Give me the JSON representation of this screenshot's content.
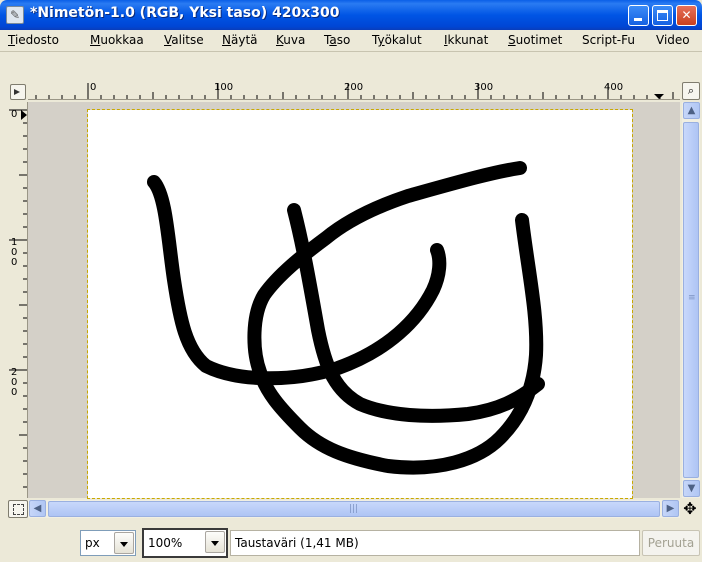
{
  "window": {
    "title": "*Nimetön-1.0 (RGB, Yksi taso) 420x300",
    "controls": {
      "minimize": "minimize",
      "maximize": "maximize",
      "close": "✕"
    }
  },
  "menu": [
    {
      "pre": "",
      "mnemonic": "T",
      "post": "iedosto"
    },
    {
      "pre": "",
      "mnemonic": "M",
      "post": "uokkaa"
    },
    {
      "pre": "",
      "mnemonic": "V",
      "post": "alitse"
    },
    {
      "pre": "",
      "mnemonic": "N",
      "post": "äytä"
    },
    {
      "pre": "",
      "mnemonic": "K",
      "post": "uva"
    },
    {
      "pre": "T",
      "mnemonic": "a",
      "post": "so"
    },
    {
      "pre": "T",
      "mnemonic": "y",
      "post": "ökalut"
    },
    {
      "pre": "",
      "mnemonic": "I",
      "post": "kkunat"
    },
    {
      "pre": "",
      "mnemonic": "S",
      "post": "uotimet"
    },
    {
      "pre": "",
      "mnemonic": "",
      "post": "Script-Fu"
    },
    {
      "pre": "",
      "mnemonic": "",
      "post": "Video"
    }
  ],
  "rulers": {
    "horizontal": [
      "0",
      "100",
      "200",
      "300",
      "400"
    ],
    "vertical": [
      "0",
      "100",
      "200"
    ]
  },
  "statusbar": {
    "unit": "px",
    "zoom": "100%",
    "message": "Taustaväri (1,41 MB)",
    "cancel": "Peruuta"
  },
  "icons": {
    "ruler_corner": "menu-arrow-icon",
    "zoom": "zoom-icon",
    "quickmask": "quick-mask-icon",
    "navigate": "navigate-cross-icon"
  },
  "colors": {
    "titlebar": "#0055E5",
    "canvas_border": "#C9A800",
    "stroke": "#000000"
  }
}
